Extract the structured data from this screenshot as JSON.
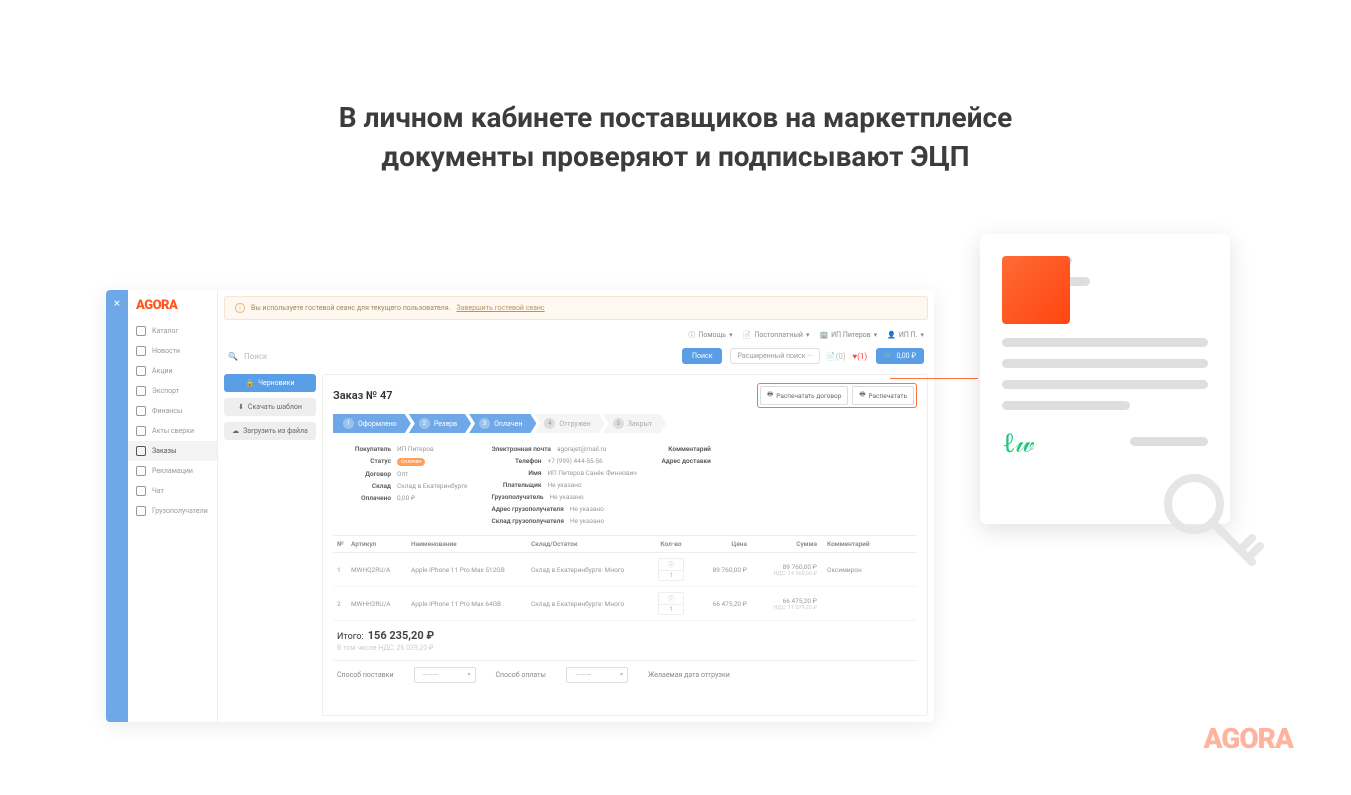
{
  "headline_line1": "В личном кабинете поставщиков на маркетплейсе",
  "headline_line2": "документы проверяют и подписывают ЭЦП",
  "logo": "AGORA",
  "alert": {
    "text": "Вы используете гостевой сеанс для текущего пользователя.",
    "link": "Завершить гостевой сеанс"
  },
  "nav": [
    "Каталог",
    "Новости",
    "Акции",
    "Экспорт",
    "Финансы",
    "Акты сверки",
    "Заказы",
    "Рекламации",
    "Чат",
    "Грузополучатели"
  ],
  "nav_active_index": 6,
  "topbar": {
    "help": "Помощь",
    "payment": "Постоплатный",
    "company": "ИП Питеров",
    "user": "ИП П."
  },
  "search": {
    "placeholder": "Поиск",
    "button": "Поиск",
    "advanced": "Расширенный поиск ···",
    "notif_count": "(0)",
    "heart_count": "(1)",
    "cart": "0,00 ₽"
  },
  "leftcol": {
    "drafts": "Черновики",
    "download": "Скачать шаблон",
    "upload": "Загрузить из файла"
  },
  "order": {
    "title": "Заказ № 47",
    "actions": {
      "print_contract": "Распечатать договор",
      "print": "Распечатать"
    },
    "steps": [
      "Оформлено",
      "Резерв",
      "Оплачен",
      "Отгружен",
      "Закрыт"
    ],
    "step_active_index": 2,
    "details_left": [
      {
        "label": "Покупатель",
        "value": "ИП Питеров"
      },
      {
        "label": "Статус",
        "badge": "Оплачен"
      },
      {
        "label": "Договор",
        "value": "Опт"
      },
      {
        "label": "Склад",
        "value": "Склад в Екатеринбурге"
      },
      {
        "label": "Оплачено",
        "value": "0,00 ₽"
      }
    ],
    "details_mid": [
      {
        "label": "Электронная почта",
        "value": "agorajet@mail.ru"
      },
      {
        "label": "Телефон",
        "value": "+7 (999) 444-55-56"
      },
      {
        "label": "Имя",
        "value": "ИП Питеров Санёк Финнович"
      },
      {
        "label": "Плательщик",
        "value": "Не указано"
      },
      {
        "label": "Грузополучатель",
        "value": "Не указано"
      },
      {
        "label": "Адрес грузополучателя",
        "value": "Не указано"
      },
      {
        "label": "Склад грузополучателя",
        "value": "Не указано"
      }
    ],
    "details_right": [
      {
        "label": "Комментарий",
        "value": ""
      },
      {
        "label": "Адрес доставки",
        "value": ""
      }
    ],
    "table": {
      "headers": [
        "№",
        "Артикул",
        "Наименование",
        "Склад/Остаток",
        "Кол-во",
        "Цена",
        "Сумма",
        "Комментарий"
      ],
      "rows": [
        {
          "n": "1",
          "sku": "MWHQ2RU/A",
          "name": "Apple iPhone 11 Pro Max 512GB",
          "stock": "Склад в Екатеринбурге: Много",
          "qty": "1",
          "price": "89 760,00 ₽",
          "sum": "89 760,00 ₽",
          "vat": "НДС: 14 960,00 ₽",
          "comment": "Оксимирон"
        },
        {
          "n": "2",
          "sku": "MWHH2RU/A",
          "name": "Apple iPhone 11 Pro Max 64GB",
          "stock": "Склад в Екатеринбурге: Много",
          "qty": "1",
          "price": "66 475,20 ₽",
          "sum": "66 475,20 ₽",
          "vat": "НДС: 11 079,20 ₽",
          "comment": ""
        }
      ]
    },
    "total_label": "Итого:",
    "total": "156 235,20 ₽",
    "vat_total": "В том числе НДС: 26 039,20 ₽",
    "footer": {
      "delivery": "Способ поставки",
      "payment": "Способ оплаты",
      "date": "Желаемая дата отгрузки",
      "dash": "———"
    }
  },
  "brand": "AGORA"
}
